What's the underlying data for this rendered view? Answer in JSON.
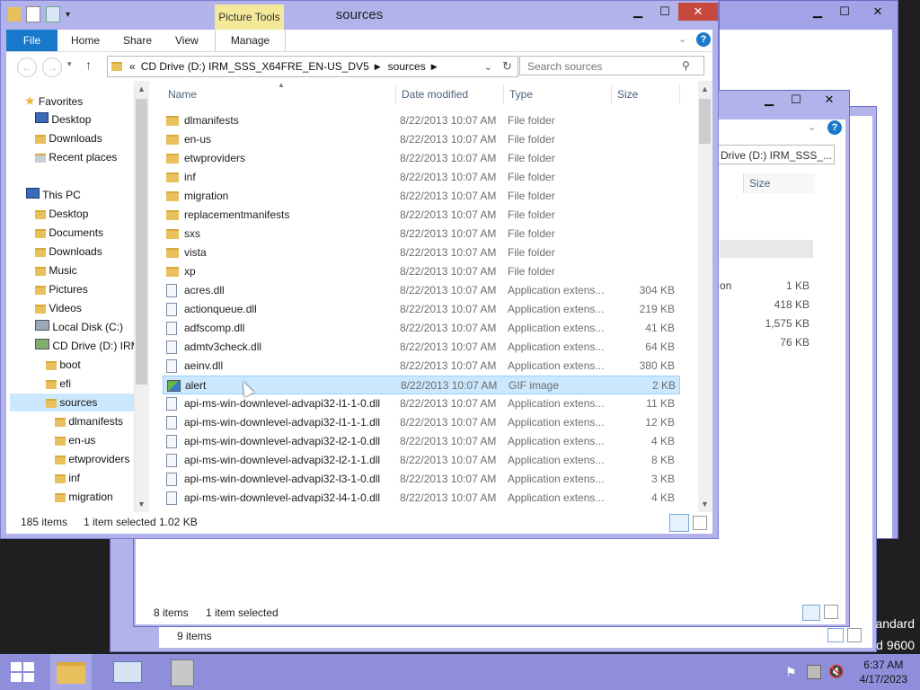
{
  "main_window": {
    "title": "sources",
    "picture_tools": "Picture Tools",
    "ribbon_tabs": [
      "File",
      "Home",
      "Share",
      "View",
      "Manage"
    ],
    "address_prefix": "«",
    "address_crumbs": [
      "CD Drive (D:) IRM_SSS_X64FRE_EN-US_DV5",
      "sources"
    ],
    "search_placeholder": "Search sources",
    "columns": [
      "Name",
      "Date modified",
      "Type",
      "Size"
    ],
    "nav": {
      "favorites": "Favorites",
      "fav_items": [
        "Desktop",
        "Downloads",
        "Recent places"
      ],
      "this_pc": "This PC",
      "pc_items": [
        "Desktop",
        "Documents",
        "Downloads",
        "Music",
        "Pictures",
        "Videos",
        "Local Disk (C:)",
        "CD Drive (D:) IRM"
      ],
      "drive_items": [
        "boot",
        "efi",
        "sources"
      ],
      "source_items": [
        "dlmanifests",
        "en-us",
        "etwproviders",
        "inf",
        "migration"
      ]
    },
    "files": [
      {
        "name": "dlmanifests",
        "date": "8/22/2013 10:07 AM",
        "type": "File folder",
        "size": "",
        "kind": "folder"
      },
      {
        "name": "en-us",
        "date": "8/22/2013 10:07 AM",
        "type": "File folder",
        "size": "",
        "kind": "folder"
      },
      {
        "name": "etwproviders",
        "date": "8/22/2013 10:07 AM",
        "type": "File folder",
        "size": "",
        "kind": "folder"
      },
      {
        "name": "inf",
        "date": "8/22/2013 10:07 AM",
        "type": "File folder",
        "size": "",
        "kind": "folder"
      },
      {
        "name": "migration",
        "date": "8/22/2013 10:07 AM",
        "type": "File folder",
        "size": "",
        "kind": "folder"
      },
      {
        "name": "replacementmanifests",
        "date": "8/22/2013 10:07 AM",
        "type": "File folder",
        "size": "",
        "kind": "folder"
      },
      {
        "name": "sxs",
        "date": "8/22/2013 10:07 AM",
        "type": "File folder",
        "size": "",
        "kind": "folder"
      },
      {
        "name": "vista",
        "date": "8/22/2013 10:07 AM",
        "type": "File folder",
        "size": "",
        "kind": "folder"
      },
      {
        "name": "xp",
        "date": "8/22/2013 10:07 AM",
        "type": "File folder",
        "size": "",
        "kind": "folder"
      },
      {
        "name": "acres.dll",
        "date": "8/22/2013 10:07 AM",
        "type": "Application extens...",
        "size": "304 KB",
        "kind": "dll"
      },
      {
        "name": "actionqueue.dll",
        "date": "8/22/2013 10:07 AM",
        "type": "Application extens...",
        "size": "219 KB",
        "kind": "dll"
      },
      {
        "name": "adfscomp.dll",
        "date": "8/22/2013 10:07 AM",
        "type": "Application extens...",
        "size": "41 KB",
        "kind": "dll"
      },
      {
        "name": "admtv3check.dll",
        "date": "8/22/2013 10:07 AM",
        "type": "Application extens...",
        "size": "64 KB",
        "kind": "dll"
      },
      {
        "name": "aeinv.dll",
        "date": "8/22/2013 10:07 AM",
        "type": "Application extens...",
        "size": "380 KB",
        "kind": "dll"
      },
      {
        "name": "alert",
        "date": "8/22/2013 10:07 AM",
        "type": "GIF image",
        "size": "2 KB",
        "kind": "gif"
      },
      {
        "name": "api-ms-win-downlevel-advapi32-l1-1-0.dll",
        "date": "8/22/2013 10:07 AM",
        "type": "Application extens...",
        "size": "11 KB",
        "kind": "dll"
      },
      {
        "name": "api-ms-win-downlevel-advapi32-l1-1-1.dll",
        "date": "8/22/2013 10:07 AM",
        "type": "Application extens...",
        "size": "12 KB",
        "kind": "dll"
      },
      {
        "name": "api-ms-win-downlevel-advapi32-l2-1-0.dll",
        "date": "8/22/2013 10:07 AM",
        "type": "Application extens...",
        "size": "4 KB",
        "kind": "dll"
      },
      {
        "name": "api-ms-win-downlevel-advapi32-l2-1-1.dll",
        "date": "8/22/2013 10:07 AM",
        "type": "Application extens...",
        "size": "8 KB",
        "kind": "dll"
      },
      {
        "name": "api-ms-win-downlevel-advapi32-l3-1-0.dll",
        "date": "8/22/2013 10:07 AM",
        "type": "Application extens...",
        "size": "3 KB",
        "kind": "dll"
      },
      {
        "name": "api-ms-win-downlevel-advapi32-l4-1-0.dll",
        "date": "8/22/2013 10:07 AM",
        "type": "Application extens...",
        "size": "4 KB",
        "kind": "dll"
      }
    ],
    "selected_file": "alert",
    "status_count": "185 items",
    "status_selected": "1 item selected",
    "status_size": "1.02 KB"
  },
  "back_window_1": {
    "address_fragment": "Drive (D:) IRM_SSS_...",
    "column_size": "Size",
    "partial_name": "on",
    "sizes": [
      "1 KB",
      "418 KB",
      "1,575 KB",
      "76 KB"
    ],
    "status_count": "8 items",
    "status_selected": "1 item selected"
  },
  "back_window_2": {
    "status_count": "9 items"
  },
  "watermark": {
    "line1": "andard",
    "line2": "d 9600"
  },
  "taskbar": {
    "time": "6:37 AM",
    "date": "4/17/2023"
  },
  "colors": {
    "window_frame": "#b3b3ec",
    "taskbar": "#8e8edb",
    "file_tab": "#1979ca",
    "selection": "#cce8ff",
    "picture_tools": "#f4e99a",
    "close_red": "#c7493e"
  }
}
